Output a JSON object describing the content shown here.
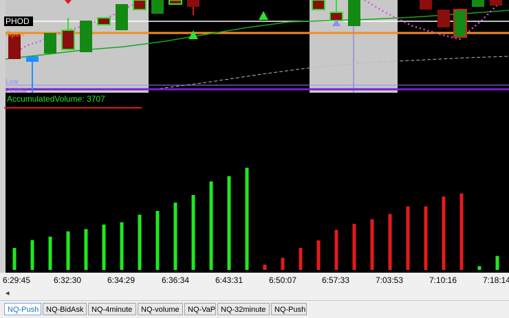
{
  "price_panel": {
    "labels": {
      "phod": "PHOD",
      "open": "Open",
      "low": "Low",
      "pclose": "PClose"
    },
    "colors": {
      "session_shade": "#c8c8c8",
      "bull": "#138a13",
      "bear": "#8b0d0d",
      "highlight": "#2fe02f",
      "phod_line": "#ffffff",
      "open_line": "#f28c1e",
      "ma_line": "#1aa51a",
      "dots": "#e14de1",
      "pclose_line": "#7b1fd6"
    }
  },
  "indicator": {
    "label": "AccumulatedVolume: 3707",
    "underline_color": "#e21b1b"
  },
  "chart_data": {
    "type": "bar",
    "title": "AccumulatedVolume: 3707",
    "x_tick_labels": [
      "6:29:45",
      "6:32:30",
      "6:34:29",
      "6:36:34",
      "6:43:31",
      "6:50:07",
      "6:57:33",
      "7:03:53",
      "7:10:16",
      "7:18:14"
    ],
    "series": [
      {
        "color": "#1ee81e",
        "values": [
          290,
          395,
          440,
          510,
          540,
          600,
          630,
          730,
          780,
          890,
          990,
          1170,
          1240,
          1350
        ]
      },
      {
        "color": "#e21b1b",
        "values": [
          70,
          160,
          290,
          390,
          530,
          610,
          670,
          740,
          840,
          840,
          970,
          1010
        ]
      },
      {
        "color": "#1ee81e",
        "values": [
          50,
          185
        ]
      }
    ],
    "ylim": [
      0,
      1500
    ]
  },
  "tabs": [
    {
      "label": "NQ-Push",
      "active": true
    },
    {
      "label": "NQ-BidAsk",
      "active": false
    },
    {
      "label": "NQ-4minute",
      "active": false
    },
    {
      "label": "NQ-volume",
      "active": false
    },
    {
      "label": "NQ-VaP",
      "active": false
    },
    {
      "label": "NQ-32minute",
      "active": false
    },
    {
      "label": "NQ-Push",
      "active": false
    }
  ],
  "scroll": {
    "left_arrow": "◂"
  }
}
